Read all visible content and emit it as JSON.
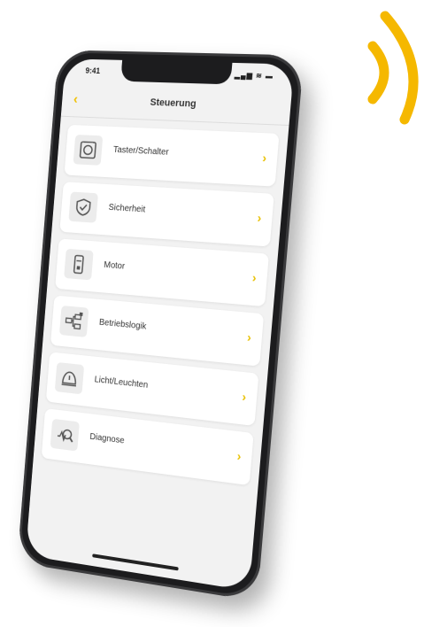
{
  "status_bar": {
    "time": "9:41",
    "indicators": "▂▄▆ ≋ ▬"
  },
  "navbar": {
    "back_icon": "chevron-left-icon",
    "back_glyph": "‹",
    "title": "Steuerung"
  },
  "menu": {
    "chevron_glyph": "›",
    "items": [
      {
        "label": "Taster/Schalter",
        "icon": "switch-icon"
      },
      {
        "label": "Sicherheit",
        "icon": "shield-check-icon"
      },
      {
        "label": "Motor",
        "icon": "motor-icon"
      },
      {
        "label": "Betriebslogik",
        "icon": "logic-icon"
      },
      {
        "label": "Licht/Leuchten",
        "icon": "lamp-icon"
      },
      {
        "label": "Diagnose",
        "icon": "diagnose-icon"
      }
    ]
  },
  "colors": {
    "accent": "#f5b800",
    "chevron": "#e8c000",
    "phone_body": "#1c1c1e",
    "screen_bg": "#f2f2f2"
  }
}
